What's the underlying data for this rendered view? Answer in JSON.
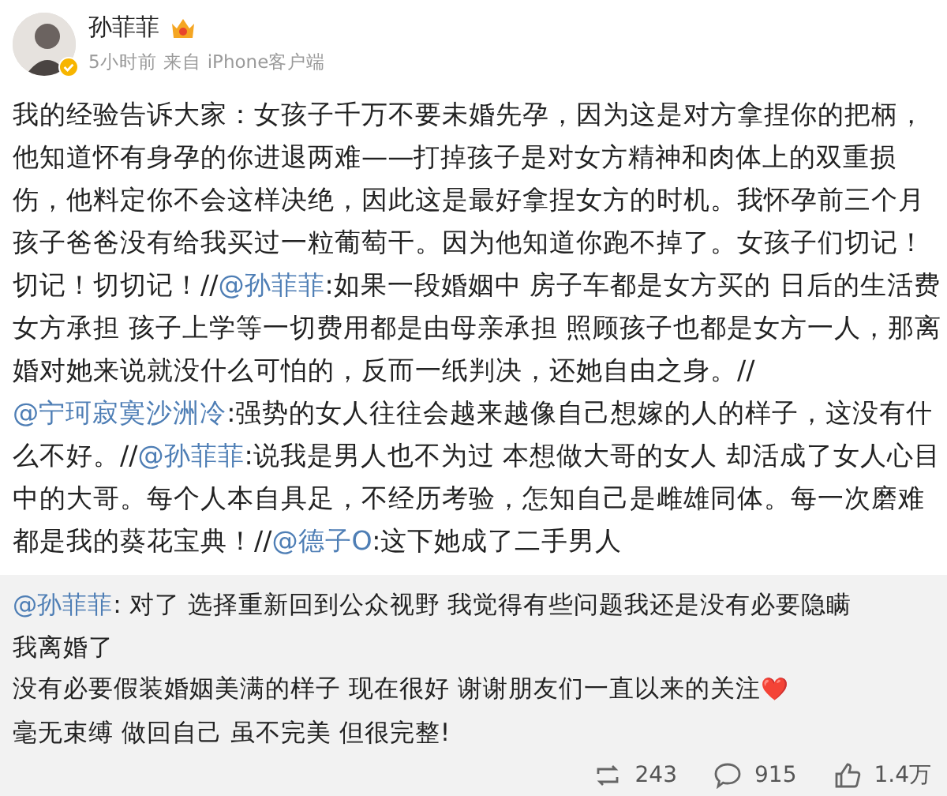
{
  "author": {
    "name": "孙菲菲",
    "verified": true,
    "member_badge": true,
    "time": "5小时前",
    "source_prefix": "来自",
    "source": "iPhone客户端"
  },
  "post": [
    {
      "kind": "text",
      "text": "我的经验告诉大家：女孩子千万不要未婚先孕，因为这是对方拿捏你的把柄，他知道怀有身孕的你进退两难——打掉孩子是对女方精神和肉体上的双重损伤，他料定你不会这样决绝，因此这是最好拿捏女方的时机。我怀孕前三个月孩子爸爸没有给我买过一粒葡萄干。因为他知道你跑不掉了。女孩子们切记！切记！切切记！//"
    },
    {
      "kind": "mention",
      "text": "@孙菲菲"
    },
    {
      "kind": "text",
      "text": ":如果一段婚姻中 房子车都是女方买的 日后的生活费女方承担 孩子上学等一切费用都是由母亲承担 照顾孩子也都是女方一人，那离婚对她来说就没什么可怕的，反而一纸判决，还她自由之身。//"
    },
    {
      "kind": "mention",
      "text": "@宁珂寂寞沙洲冷"
    },
    {
      "kind": "text",
      "text": ":强势的女人往往会越来越像自己想嫁的人的样子，这没有什么不好。//"
    },
    {
      "kind": "mention",
      "text": "@孙菲菲"
    },
    {
      "kind": "text",
      "text": ":说我是男人也不为过 本想做大哥的女人 却活成了女人心目中的大哥。每个人本自具足，不经历考验，怎知自己是雌雄同体。每一次磨难都是我的葵花宝典！//"
    },
    {
      "kind": "mention",
      "text": "@德子O"
    },
    {
      "kind": "text",
      "text": ":这下她成了二手男人"
    }
  ],
  "original": {
    "lines": [
      [
        {
          "kind": "mention",
          "text": "@孙菲菲"
        },
        {
          "kind": "text",
          "text": ": 对了 选择重新回到公众视野 我觉得有些问题我还是没有必要隐瞒"
        }
      ],
      [
        {
          "kind": "text",
          "text": "我离婚了"
        }
      ],
      [
        {
          "kind": "text",
          "text": "没有必要假装婚姻美满的样子 现在很好 谢谢朋友们一直以来的关注"
        },
        {
          "kind": "emoji",
          "text": "❤️"
        }
      ],
      [
        {
          "kind": "text",
          "text": "毫无束缚 做回自己 虽不完美 但很完整!"
        }
      ]
    ],
    "actions": [
      {
        "kind": "repost",
        "count": "243"
      },
      {
        "kind": "comment",
        "count": "915"
      },
      {
        "kind": "like",
        "count": "1.4万"
      }
    ]
  }
}
